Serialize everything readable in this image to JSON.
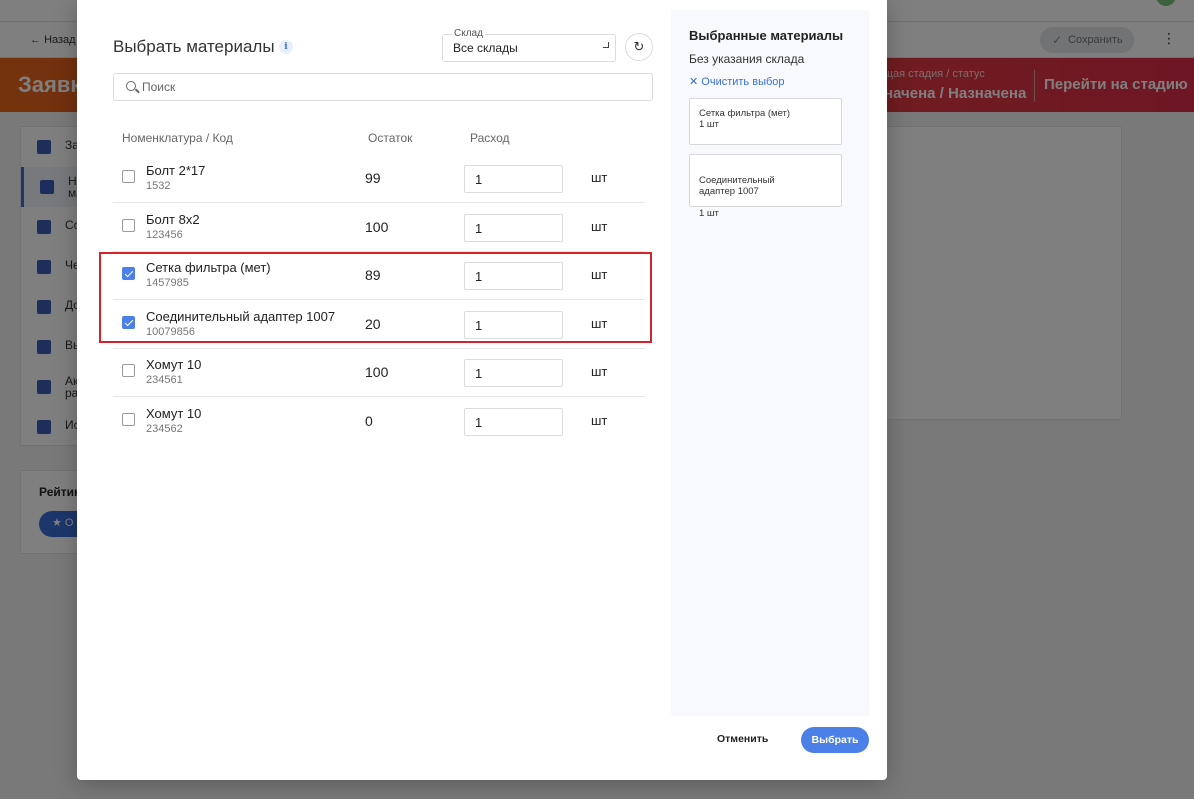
{
  "background": {
    "back_label": "Назад",
    "save_label": "Сохранить",
    "kebab": "⋮",
    "banner_title": "Заявк",
    "stage_label": "щая стадия / статус",
    "stage_value": "начена / Назначена",
    "stage_go": "Перейти на стадию",
    "sidebar_items": [
      {
        "label": "За"
      },
      {
        "label": "Не\nма"
      },
      {
        "label": "Со"
      },
      {
        "label": "Че"
      },
      {
        "label": "До"
      },
      {
        "label": "Вы"
      },
      {
        "label": "Ак\nра"
      },
      {
        "label": "Ис"
      }
    ],
    "rating_title": "Рейтин",
    "rating_pill": "★ О"
  },
  "modal": {
    "title": "Выбрать материалы",
    "info_icon": "i",
    "warehouse": {
      "label": "Склад",
      "value": "Все склады"
    },
    "refresh_icon": "↻",
    "search": {
      "placeholder": "Поиск",
      "value": ""
    },
    "columns": {
      "name": "Номенклатура / Код",
      "stock": "Остаток",
      "usage": "Расход"
    },
    "rows": [
      {
        "name": "Болт 2*17",
        "code": "1532",
        "stock": "99",
        "qty": "1",
        "unit": "шт",
        "checked": false
      },
      {
        "name": "Болт 8х2",
        "code": "123456",
        "stock": "100",
        "qty": "1",
        "unit": "шт",
        "checked": false
      },
      {
        "name": "Сетка фильтра (мет)",
        "code": "1457985",
        "stock": "89",
        "qty": "1",
        "unit": "шт",
        "checked": true
      },
      {
        "name": "Соединительный адаптер 1007",
        "code": "10079856",
        "stock": "20",
        "qty": "1",
        "unit": "шт",
        "checked": true
      },
      {
        "name": "Хомут 10",
        "code": "234561",
        "stock": "100",
        "qty": "1",
        "unit": "шт",
        "checked": false
      },
      {
        "name": "Хомут 10",
        "code": "234562",
        "stock": "0",
        "qty": "1",
        "unit": "шт",
        "checked": false
      }
    ],
    "selected": {
      "title": "Выбранные материалы",
      "subtitle": "Без указания склада",
      "clear_label": "Очистить выбор",
      "clear_icon": "✕",
      "items": [
        {
          "name": "Сетка фильтра (мет)",
          "qty": "1 шт"
        },
        {
          "name": "Соединительный\nадаптер 1007",
          "qty": "1 шт"
        }
      ]
    },
    "cancel_label": "Отменить",
    "select_label": "Выбрать"
  },
  "colors": {
    "accent": "#4a80e8",
    "highlight": "#d6232a",
    "banner_start": "#e8661a",
    "banner_end": "#df2c48"
  }
}
